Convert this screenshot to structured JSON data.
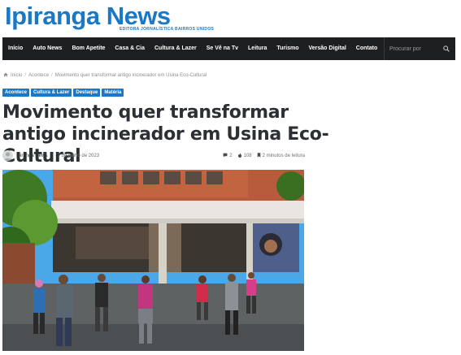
{
  "site": {
    "logo_text": "Ipiranga News",
    "logo_tagline": "EDITORA JORNALÍSTICA BAIRROS UNIDOS",
    "brand_color": "#1b78c6"
  },
  "nav": {
    "items": [
      "Início",
      "Auto News",
      "Bom Apetite",
      "Casa & Cia",
      "Cultura & Lazer",
      "Se Vê na Tv",
      "Leitura",
      "Turismo",
      "Versão Digital",
      "Contato"
    ],
    "search_placeholder": "Procurar por",
    "search_icon": "search-icon"
  },
  "breadcrumb": {
    "home_icon": "home-icon",
    "home": "Início",
    "separator": "/",
    "category": "Acontece",
    "current": "Movimento quer transformar antigo incinerador em Usina Eco-Cultural"
  },
  "tags": [
    "Acontece",
    "Cultura & Lazer",
    "Destaque",
    "Matéria"
  ],
  "article": {
    "title": "Movimento quer transformar antigo incinerador em Usina Eco-Cultural",
    "author": "Ipiranga News",
    "date": "7 de junho de 2023",
    "comments": "2",
    "views": "108",
    "read_time": "2 minutos de leitura"
  }
}
